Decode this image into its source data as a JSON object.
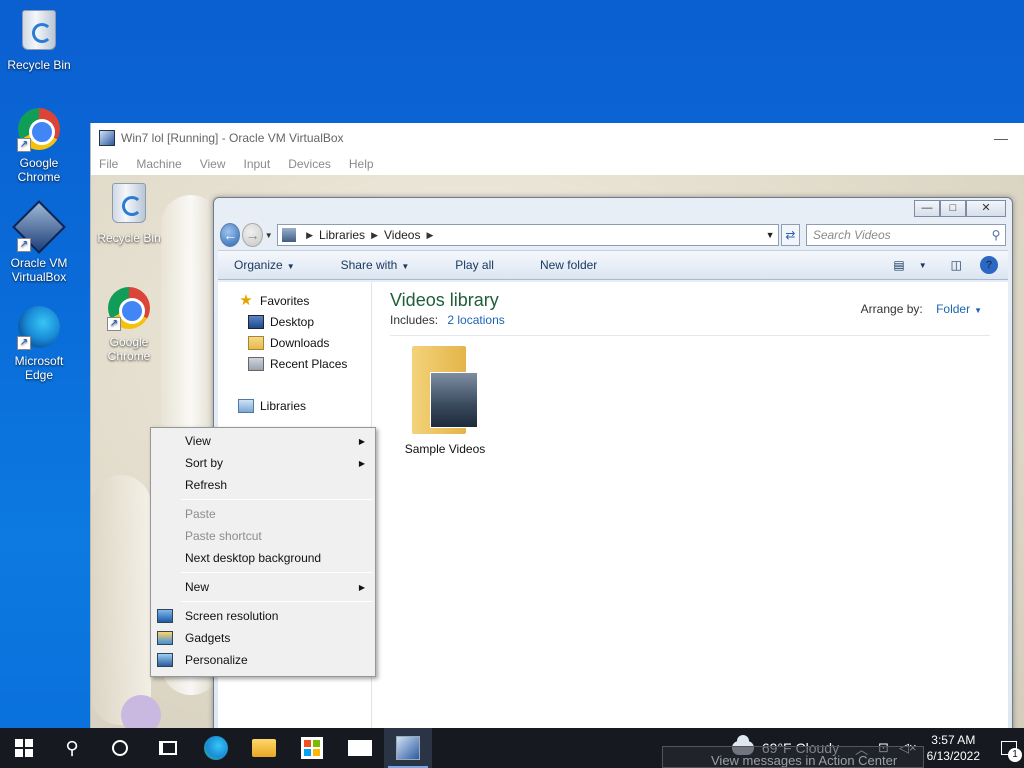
{
  "host_desktop": {
    "icons": [
      {
        "label": "Recycle Bin",
        "icon": "recycle-bin-icon"
      },
      {
        "label": "Google Chrome",
        "icon": "chrome-icon"
      },
      {
        "label": "Oracle VM VirtualBox",
        "icon": "virtualbox-icon"
      },
      {
        "label": "Microsoft Edge",
        "icon": "edge-icon"
      }
    ]
  },
  "vbox_window": {
    "title": "Win7 lol [Running] - Oracle VM VirtualBox",
    "minimize_glyph": "—",
    "menu": [
      "File",
      "Machine",
      "View",
      "Input",
      "Devices",
      "Help"
    ]
  },
  "guest_desktop": {
    "icons": [
      {
        "label": "Recycle Bin",
        "icon": "recycle-bin-icon"
      },
      {
        "label": "Google Chrome",
        "icon": "chrome-icon"
      }
    ]
  },
  "explorer": {
    "caption_buttons": {
      "minimize": "—",
      "maximize": "□",
      "close": "✕"
    },
    "address": {
      "crumbs": [
        "Libraries",
        "Videos"
      ]
    },
    "search_placeholder": "Search Videos",
    "commands": [
      "Organize",
      "Share with",
      "Play all",
      "New folder"
    ],
    "nav": {
      "favorites": "Favorites",
      "favorites_items": [
        "Desktop",
        "Downloads",
        "Recent Places"
      ],
      "libraries": "Libraries"
    },
    "library": {
      "title": "Videos library",
      "includes_label": "Includes:",
      "includes_link": "2 locations",
      "arrange_label": "Arrange by:",
      "arrange_value": "Folder"
    },
    "items": [
      {
        "name": "Sample Videos"
      }
    ]
  },
  "context_menu": {
    "view": "View",
    "sort_by": "Sort by",
    "refresh": "Refresh",
    "paste": "Paste",
    "paste_shortcut": "Paste shortcut",
    "next_bg": "Next desktop background",
    "new": "New",
    "screen_resolution": "Screen resolution",
    "gadgets": "Gadgets",
    "personalize": "Personalize"
  },
  "taskbar": {
    "weather": "69°F  Cloudy",
    "time": "3:57 AM",
    "date": "6/13/2022",
    "notification_count": "1",
    "toast_hint": "View messages in Action Center"
  }
}
